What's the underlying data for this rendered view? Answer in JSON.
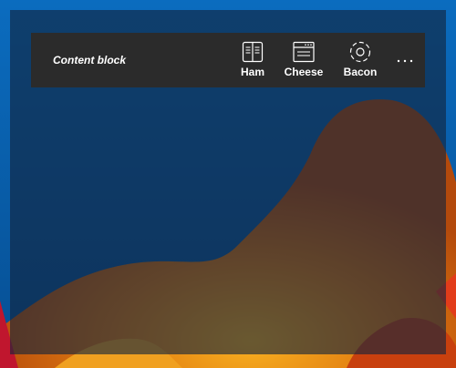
{
  "toolbar": {
    "title": "Content block",
    "buttons": [
      {
        "label": "Ham",
        "icon": "book-icon"
      },
      {
        "label": "Cheese",
        "icon": "browser-window-icon"
      },
      {
        "label": "Bacon",
        "icon": "target-icon"
      }
    ],
    "more_label": "…"
  },
  "colors": {
    "toolbar_bg": "#2b2b2b",
    "overlay": "#12243c",
    "text": "#ffffff"
  }
}
